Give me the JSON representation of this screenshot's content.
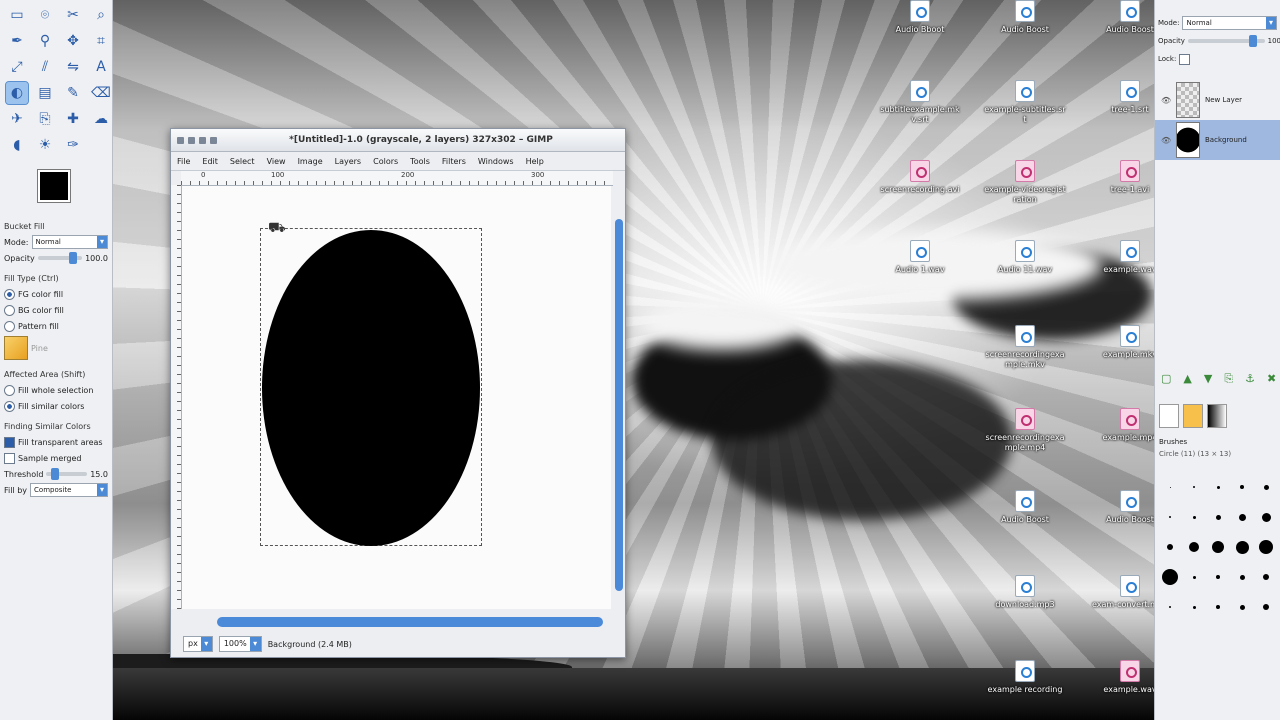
{
  "toolbox": {
    "tool_icons": [
      "rect-select-icon",
      "ellipse-select-icon",
      "free-select-icon",
      "zoom-icon",
      "paths-icon",
      "color-picker-icon",
      "move-icon",
      "crop-icon",
      "scale-icon",
      "shear-icon",
      "flip-icon",
      "text-icon",
      "bucket-fill-icon",
      "blend-icon",
      "pencil-icon",
      "eraser-icon",
      "airbrush-icon",
      "clone-icon",
      "heal-icon",
      "smudge-icon",
      "dodge-icon",
      "burn-icon",
      "ink-icon"
    ],
    "tool_glyphs": [
      "▭",
      "⌾",
      "✂",
      "⌕",
      "✒",
      "⚲",
      "✥",
      "⌗",
      "⤢",
      "⫽",
      "⇋",
      "A",
      "◐",
      "▤",
      "✎",
      "⌫",
      "✈",
      "⎘",
      "✚",
      "☁",
      "◖",
      "☀",
      "✑"
    ],
    "options": {
      "title": "Bucket Fill",
      "mode_label": "Mode:",
      "mode_value": "Normal",
      "opacity_label": "Opacity",
      "opacity_value": "100.0",
      "fill_type_label": "Fill Type (Ctrl)",
      "fill_fg": "FG color fill",
      "fill_bg": "BG color fill",
      "fill_pattern": "Pattern fill",
      "pattern_name": "Pine",
      "affected_label": "Affected Area (Shift)",
      "fill_selection": "Fill whole selection",
      "fill_similar": "Fill similar colors",
      "finding_label": "Finding Similar Colors",
      "fill_transparent": "Fill transparent areas",
      "sample_merged": "Sample merged",
      "threshold_label": "Threshold",
      "threshold_value": "15.0",
      "fill_by_label": "Fill by",
      "fill_by_value": "Composite"
    }
  },
  "image_window": {
    "title": "*[Untitled]-1.0 (grayscale, 2 layers) 327x302 – GIMP",
    "menus": [
      "File",
      "Edit",
      "Select",
      "View",
      "Image",
      "Layers",
      "Colors",
      "Tools",
      "Filters",
      "Windows",
      "Help"
    ],
    "ruler_labels": [
      "0",
      "100",
      "200",
      "300"
    ],
    "status_unit": "px",
    "status_zoom": "100%",
    "status_text": "Background (2.4 MB)"
  },
  "desktop_icons": [
    {
      "label": "Audio Bboot",
      "kind": "blue"
    },
    {
      "label": "Audio Boost",
      "kind": "blue"
    },
    {
      "label": "Audio Boost",
      "kind": "blue"
    },
    {
      "label": "subtitleexample.mkv.srt",
      "kind": "blue"
    },
    {
      "label": "example-subtitles.srt",
      "kind": "blue"
    },
    {
      "label": "tree-1.srt",
      "kind": "blue"
    },
    {
      "label": "screenrecording.avi",
      "kind": "pink"
    },
    {
      "label": "example-videoregistration",
      "kind": "pink"
    },
    {
      "label": "tree-1.avi",
      "kind": "pink"
    },
    {
      "label": "Audio 1.wav",
      "kind": "blue"
    },
    {
      "label": "Audio 11.wav",
      "kind": "blue"
    },
    {
      "label": "example.wav",
      "kind": "blue"
    },
    {
      "label": "screenrecordingexample.mkv",
      "kind": "blue"
    },
    {
      "label": "example.mkv",
      "kind": "blue"
    },
    {
      "label": "screenrecordingexample.mp4",
      "kind": "pink"
    },
    {
      "label": "example.mp4",
      "kind": "pink"
    },
    {
      "label": "Audio Boost",
      "kind": "blue"
    },
    {
      "label": "Audio Boost",
      "kind": "blue"
    },
    {
      "label": "download.mp3",
      "kind": "blue"
    },
    {
      "label": "exam-convert.mp3",
      "kind": "blue"
    },
    {
      "label": "example recording",
      "kind": "blue"
    },
    {
      "label": "example.wav",
      "kind": "pink"
    }
  ],
  "dock": {
    "mode_label": "Mode:",
    "mode_value": "Normal",
    "opacity_label": "Opacity",
    "opacity_value": "100",
    "lock_label": "Lock:",
    "layers": [
      {
        "name": "New Layer",
        "selected": false
      },
      {
        "name": "Background",
        "selected": true
      }
    ],
    "brushes_title": "Brushes",
    "brush_name": "Circle (11) (13 × 13)"
  },
  "colors": {
    "accent": "#4a8ad8",
    "selected_layer": "#9fb8e0",
    "foreground": "#000000",
    "background": "#ffffff"
  }
}
